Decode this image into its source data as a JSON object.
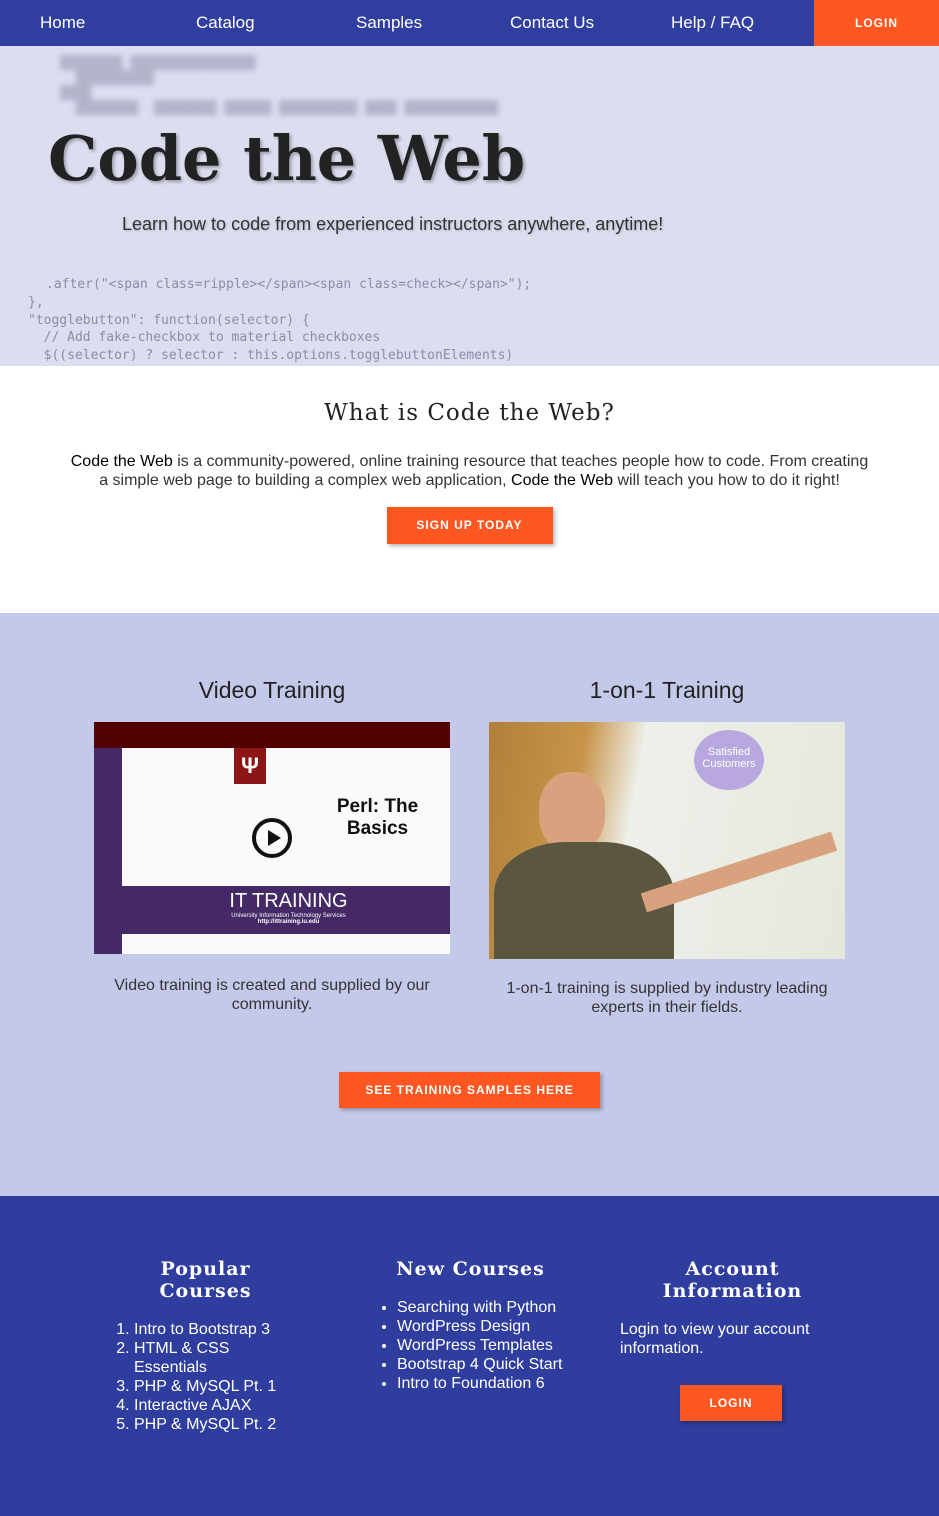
{
  "nav": {
    "items": [
      "Home",
      "Catalog",
      "Samples",
      "Contact Us",
      "Help / FAQ"
    ],
    "login": "LOGIN"
  },
  "hero": {
    "title": "Code the Web",
    "subtitle": "Learn how to code from experienced instructors anywhere, anytime!",
    "code_lines": [
      ".after(\"<span class=ripple></span><span class=check></span>\");",
      "},",
      "\"togglebutton\": function(selector) {",
      "  // Add fake-checkbox to material checkboxes",
      "  $((selector) ? selector : this.options.togglebuttonElements)"
    ]
  },
  "about": {
    "title": "What is Code the Web?",
    "brand": "Code the Web",
    "text1": " is a community-powered, online training resource that teaches people how to code. From creating a simple web page to building a complex web application, ",
    "text2": " will teach you how to do it right!",
    "button": "SIGN UP TODAY"
  },
  "training": {
    "video": {
      "title": "Video Training",
      "caption": "Video training is created and supplied by our community.",
      "thumb_title": "Perl: The Basics",
      "thumb_banner": "IT TRAINING",
      "thumb_sub": "University Information Technology Services",
      "thumb_url": "http://ittraining.iu.edu"
    },
    "one": {
      "title": "1-on-1 Training",
      "caption": "1-on-1 training is supplied by industry leading experts in their fields.",
      "photo_text": "Satisfied Customers"
    },
    "button": "SEE TRAINING SAMPLES HERE"
  },
  "footer": {
    "popular": {
      "title": "Popular Courses",
      "items": [
        "Intro to Bootstrap 3",
        "HTML & CSS Essentials",
        "PHP & MySQL Pt. 1",
        "Interactive AJAX",
        "PHP & MySQL Pt. 2"
      ]
    },
    "new": {
      "title": "New Courses",
      "items": [
        "Searching with Python",
        "WordPress Design",
        "WordPress Templates",
        "Bootstrap 4 Quick Start",
        "Intro to Foundation 6"
      ]
    },
    "account": {
      "title": "Account Information",
      "text": "Login to view your account information.",
      "button": "LOGIN"
    }
  },
  "colors": {
    "nav": "#303f9f",
    "accent": "#ff5722",
    "training_bg": "#c5c9e9",
    "footer": "#2e3d9e"
  }
}
